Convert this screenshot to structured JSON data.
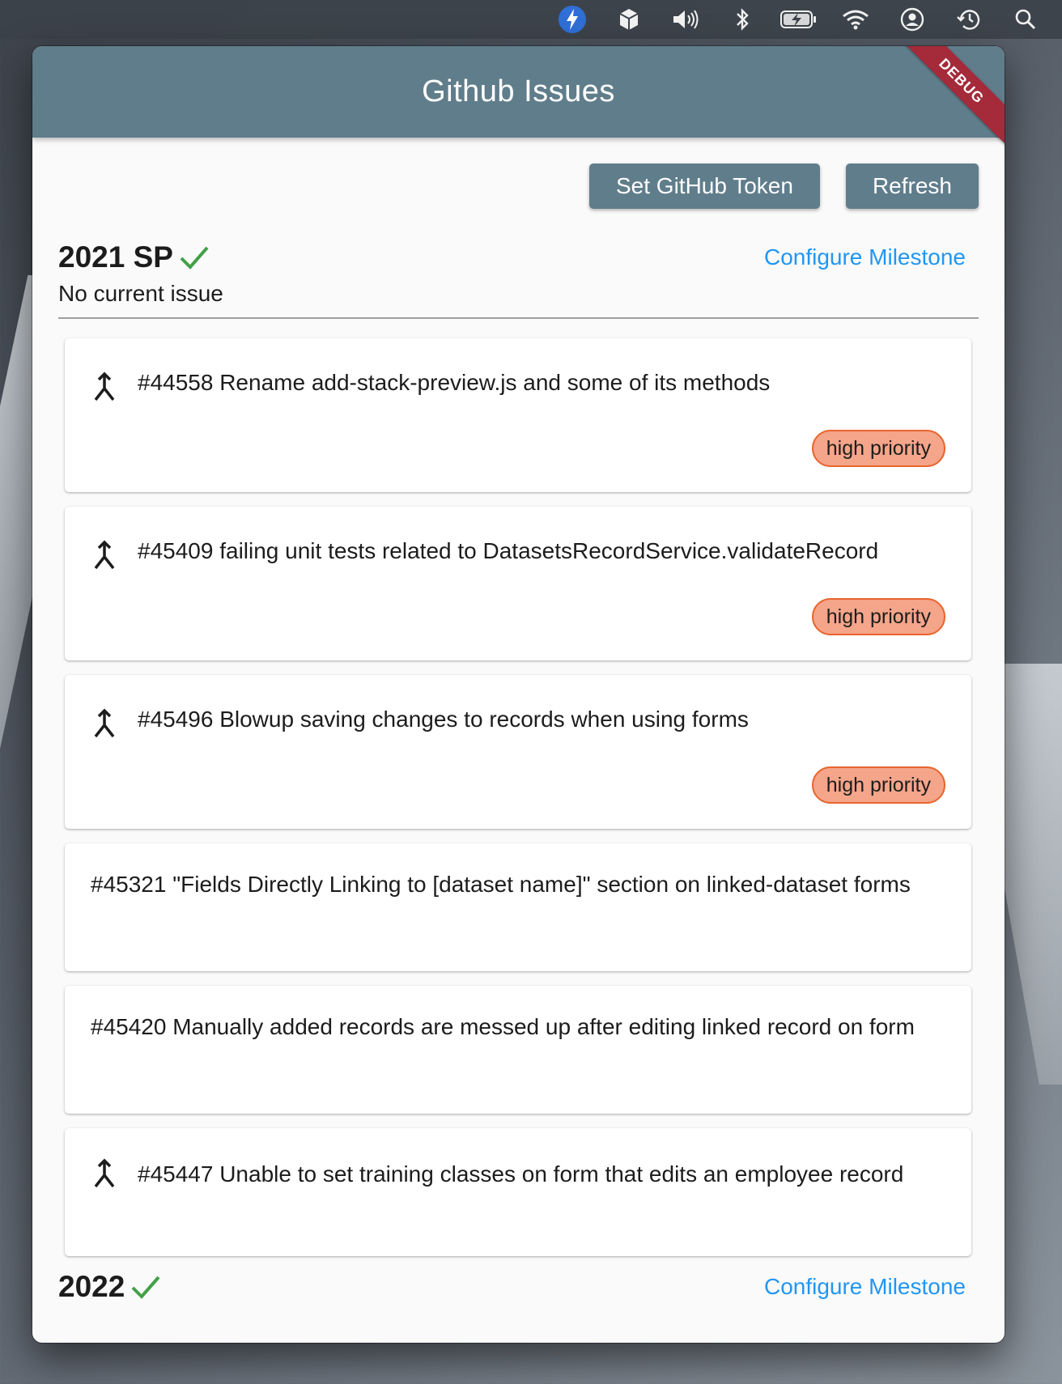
{
  "menubar": {
    "icons": [
      "lightning-app-icon",
      "cube-app-icon",
      "volume-icon",
      "bluetooth-icon",
      "battery-icon",
      "wifi-icon",
      "user-account-icon",
      "time-machine-icon",
      "spotlight-search-icon"
    ]
  },
  "app": {
    "title": "Github Issues",
    "debug_label": "DEBUG",
    "primary_color": "#607d8b",
    "link_color": "#2196f3",
    "check_color": "#43a047"
  },
  "toolbar": {
    "token_label": "Set GitHub Token",
    "refresh_label": "Refresh"
  },
  "milestones": [
    {
      "title": "2021 SP",
      "configure_label": "Configure Milestone",
      "status": "No current issue",
      "issues": [
        {
          "text": "#44558 Rename add-stack-preview.js and some of its methods",
          "has_pr": true,
          "label": "high priority"
        },
        {
          "text": "#45409 failing unit tests related to DatasetsRecordService.validateRecord",
          "has_pr": true,
          "label": "high priority"
        },
        {
          "text": "#45496 Blowup saving changes to records when using forms",
          "has_pr": true,
          "label": "high priority"
        },
        {
          "text": "#45321 \"Fields Directly Linking to [dataset name]\" section on linked-dataset forms",
          "has_pr": false
        },
        {
          "text": "#45420 Manually added records are messed up after editing linked record on form",
          "has_pr": false
        },
        {
          "text": "#45447 Unable to set training classes on form that edits an employee record",
          "has_pr": true
        }
      ]
    },
    {
      "title": "2022",
      "configure_label": "Configure Milestone"
    }
  ]
}
